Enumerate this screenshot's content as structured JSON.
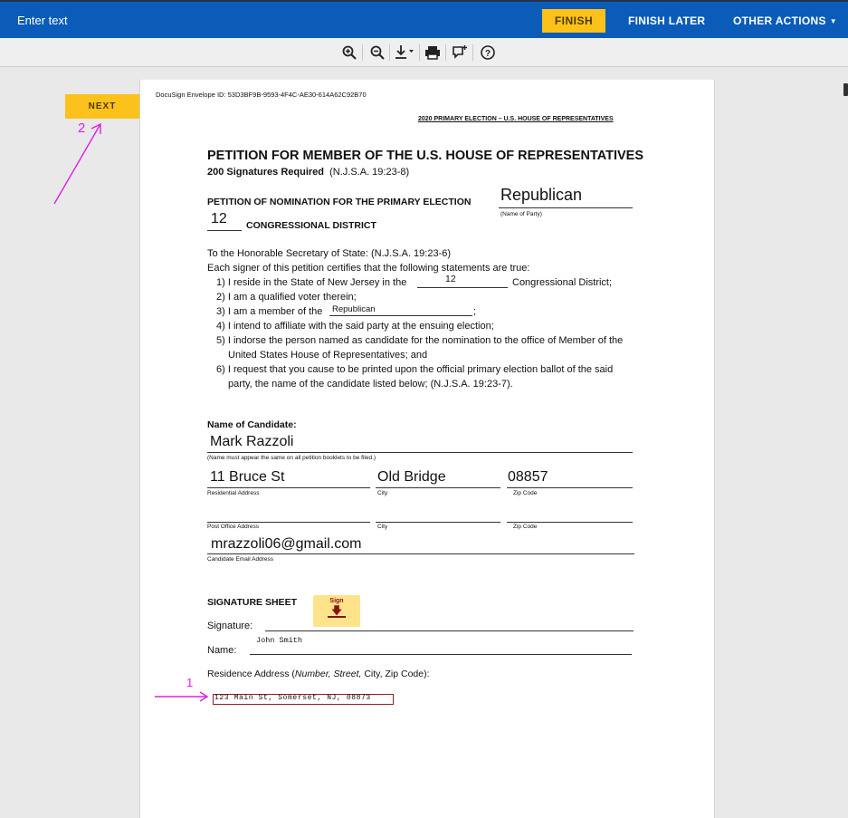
{
  "topbar": {
    "field_text": "Enter text",
    "finish_label": "FINISH",
    "finish_later_label": "FINISH LATER",
    "other_actions_label": "OTHER ACTIONS",
    "accent_color": "#0b5cb8",
    "button_color": "#fcc21b"
  },
  "toolbar": {
    "icons": [
      "zoom-in-icon",
      "zoom-out-icon",
      "download-icon",
      "print-icon",
      "comment-icon",
      "help-icon"
    ]
  },
  "nav": {
    "next_label": "NEXT"
  },
  "annotations": {
    "marker_1": "1",
    "marker_2": "2",
    "color": "#e020e0"
  },
  "document": {
    "envelope_id": "DocuSign Envelope ID: 53D3BF9B-9593-4F4C-AE30-614A62C92B70",
    "header_right": "2020 PRIMARY ELECTION – U.S. HOUSE OF REPRESENTATIVES",
    "title": "PETITION FOR MEMBER OF THE U.S. HOUSE OF REPRESENTATIVES",
    "signatures_required": "200 Signatures Required",
    "statute_1": "(N.J.S.A. 19:23-8)",
    "nomination_label": "PETITION OF NOMINATION FOR THE PRIMARY ELECTION",
    "party_value": "Republican",
    "party_caption": "(Name of Party)",
    "district_value": "12",
    "district_label": "CONGRESSIONAL DISTRICT",
    "intro_line_1": "To the Honorable Secretary of State:   (N.J.S.A. 19:23-6)",
    "intro_line_2": "Each signer of this petition certifies that the following statements are true:",
    "stmt_1_pre": "1) I reside in the State of New Jersey in the",
    "stmt_1_val": "12",
    "stmt_1_post": "Congressional District;",
    "stmt_2": "2) I am a qualified voter therein;",
    "stmt_3_pre": "3) I am a member of the",
    "stmt_3_val": "Republican",
    "stmt_3_post": ";",
    "stmt_4": "4) I intend to affiliate with the said party at the ensuing election;",
    "stmt_5a": "5) I indorse the person named as candidate for the nomination to the office of Member of the",
    "stmt_5b": "United States House of Representatives; and",
    "stmt_6a": "6) I request that you cause to be printed upon the official primary election ballot of the said",
    "stmt_6b": "party, the name of the candidate listed below; (N.J.S.A. 19:23-7).",
    "candidate_heading": "Name of Candidate:",
    "candidate_name": "Mark Razzoli",
    "candidate_caption": "(Name must appear the same on all petition booklets to be filed.)",
    "residential_address": "11 Bruce St",
    "residential_caption": "Residential Address",
    "city_value": "Old Bridge",
    "city_caption": "City",
    "zip_value": "08857",
    "zip_caption": "Zip Code",
    "po_caption": "Post Office Address",
    "city_caption_2": "City",
    "zip_caption_2": "Zip Code",
    "email_value": "mrazzoli06@gmail.com",
    "email_caption": "Candidate Email Address",
    "signature_heading": "SIGNATURE SHEET",
    "sign_tag_label": "Sign",
    "signature_label": "Signature:",
    "name_label": "Name:",
    "name_value": "John Smith",
    "residence_label_pre": "Residence Address (",
    "residence_label_italic": "Number, Street,",
    "residence_label_post": " City, Zip Code):",
    "residence_value": "123 Main St, Somerset, NJ, 08873"
  }
}
